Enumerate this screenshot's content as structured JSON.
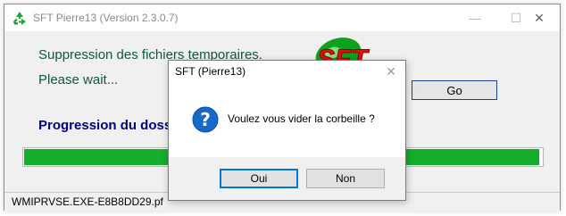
{
  "main_window": {
    "title": "SFT Pierre13 (Version 2.3.0.7)",
    "status_line": "Suppression des fichiers temporaires.",
    "wait_line": "Please wait...",
    "progress_label": "Progression du dossi",
    "go_label": "Go",
    "logo_text": "SFT",
    "progress_fraction": 0.995,
    "status_bar": "WMIPRVSE.EXE-E8B8DD29.pf",
    "controls": {
      "minimize": "—",
      "maximize": "☐",
      "close": "✕"
    }
  },
  "dialog": {
    "title": "SFT (Pierre13)",
    "close_glyph": "✕",
    "message": "Voulez vous vider la corbeille ?",
    "icon": "question-icon",
    "buttons": {
      "yes": "Oui",
      "no": "Non"
    }
  },
  "colors": {
    "status_text": "#0b5a3a",
    "progress_label": "#00007f",
    "progress_fill": "#15ae2c",
    "logo_green": "#10a020",
    "logo_red": "#e01010",
    "question_icon": "#1769c9"
  }
}
